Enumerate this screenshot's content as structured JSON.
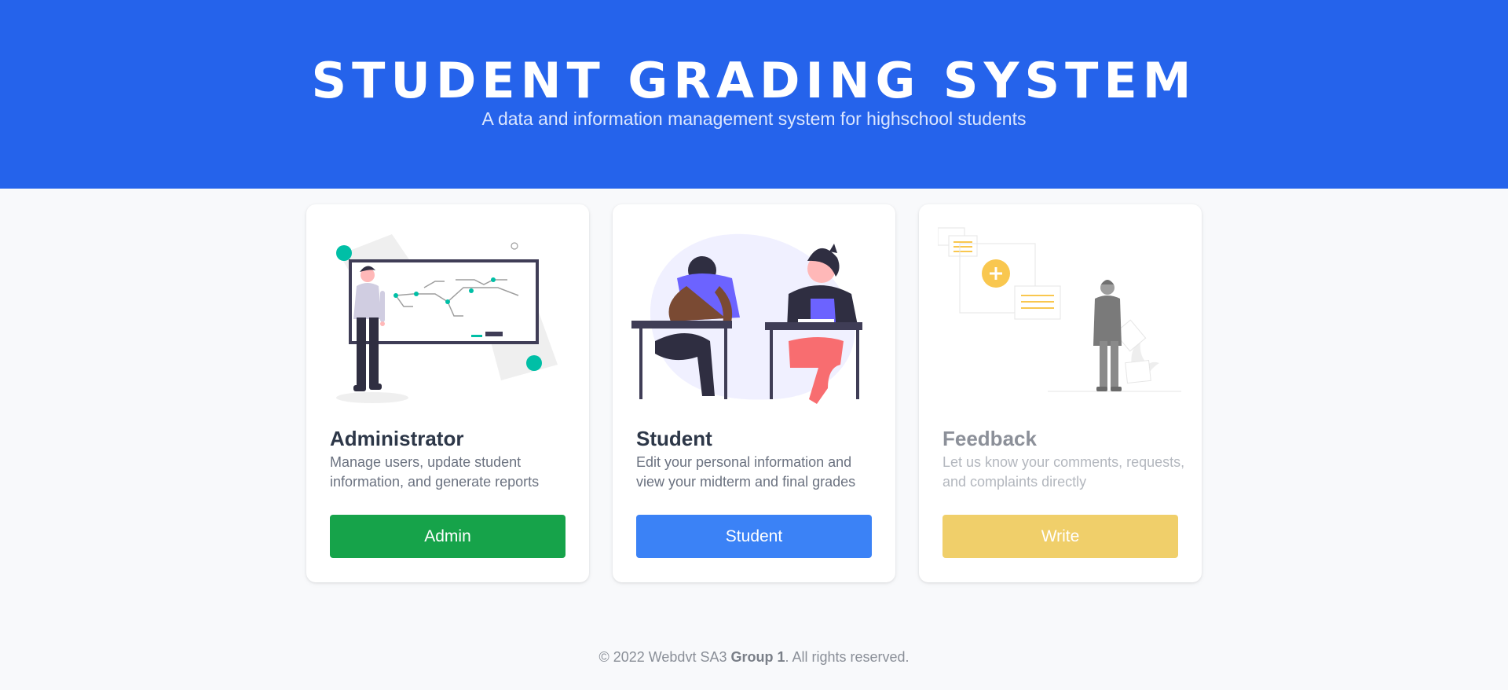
{
  "header": {
    "title": "STUDENT GRADING SYSTEM",
    "subtitle": "A data and information management system for highschool students"
  },
  "cards": [
    {
      "title": "Administrator",
      "description": "Manage users, update student information, and generate reports",
      "button_label": "Admin",
      "button_color": "#16a34a",
      "illustration": "teacher-whiteboard-illustration"
    },
    {
      "title": "Student",
      "description": "Edit your personal information and view your midterm and final grades",
      "button_label": "Student",
      "button_color": "#3b82f6",
      "illustration": "students-at-desks-illustration"
    },
    {
      "title": "Feedback",
      "description": "Let us know your comments, requests, and complaints directly",
      "button_label": "Write",
      "button_color": "#f0cf6a",
      "illustration": "feedback-documents-illustration"
    }
  ],
  "footer": {
    "prefix": "© 2022 Webdvt SA3 ",
    "group": "Group 1",
    "suffix": ". All rights reserved."
  },
  "colors": {
    "header_bg": "#2563eb",
    "page_bg": "#f8f9fb",
    "accent_teal": "#00bfa6",
    "accent_purple": "#6c63ff",
    "accent_yellow": "#f9c74f"
  }
}
